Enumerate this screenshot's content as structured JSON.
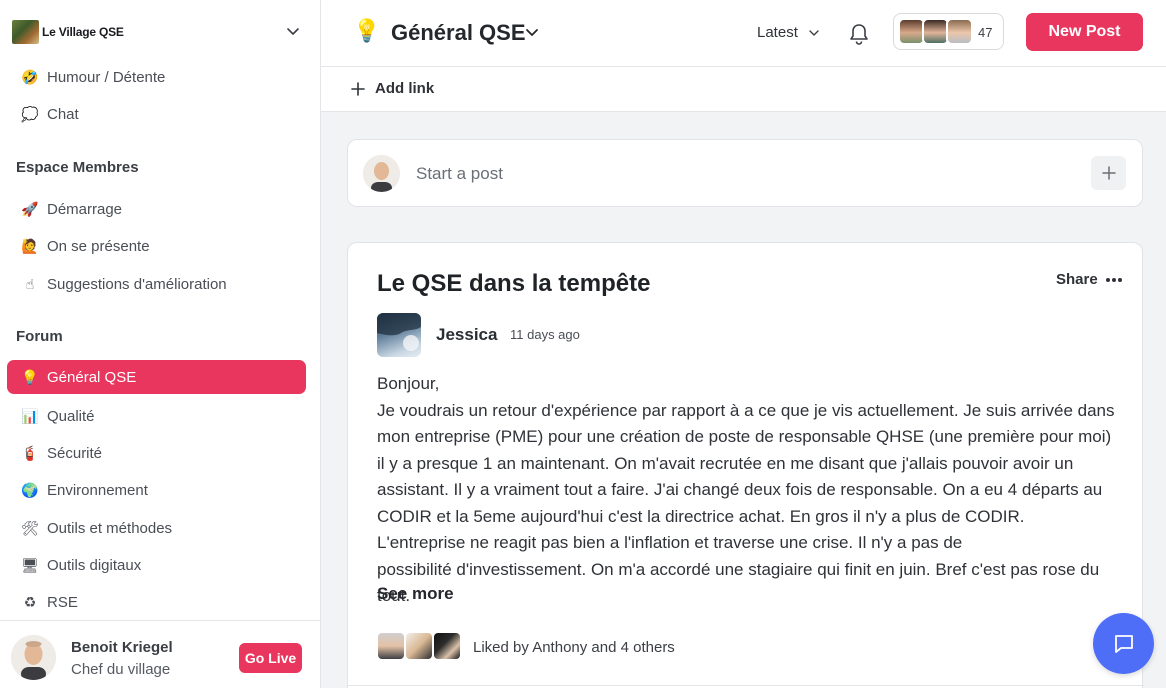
{
  "brand": {
    "name": "Le Village QSE"
  },
  "sidebar": {
    "items_top": [
      {
        "label": "Humour / Détente",
        "icon": "🤣"
      },
      {
        "label": "Chat",
        "icon": "💭"
      }
    ],
    "section_members": "Espace Membres",
    "items_members": [
      {
        "label": "Démarrage",
        "icon": "🚀"
      },
      {
        "label": "On se présente",
        "icon": "🙋"
      },
      {
        "label": "Suggestions d'amélioration",
        "icon": "☝"
      }
    ],
    "section_forum": "Forum",
    "items_forum": [
      {
        "label": "Général QSE",
        "icon": "💡"
      },
      {
        "label": "Qualité",
        "icon": "📊"
      },
      {
        "label": "Sécurité",
        "icon": "🧯"
      },
      {
        "label": "Environnement",
        "icon": "🌍"
      },
      {
        "label": "Outils et méthodes",
        "icon": "🛠"
      },
      {
        "label": "Outils digitaux",
        "icon": "🖥"
      },
      {
        "label": "RSE",
        "icon": "♻"
      }
    ]
  },
  "user": {
    "name": "Benoit Kriegel",
    "role": "Chef du village",
    "go_live": "Go Live"
  },
  "header": {
    "space_icon": "💡",
    "space_title": "Général QSE",
    "sort_label": "Latest",
    "member_count": "47",
    "new_post": "New Post",
    "add_link": "Add link"
  },
  "composer": {
    "placeholder": "Start a post"
  },
  "post": {
    "title": "Le QSE dans la tempête",
    "share": "Share",
    "author": "Jessica",
    "time": "11 days ago",
    "greeting": "Bonjour,",
    "body": "Je voudrais un retour d'expérience par rapport à a ce que je vis actuellement. Je suis arrivée dans mon entreprise (PME) pour une création de poste de responsable QHSE (une première pour moi) il y a presque 1 an maintenant. On m'avait recrutée en me disant que j'allais pouvoir avoir un assistant. Il y a vraiment tout a faire. J'ai changé deux fois de responsable. On a eu 4 départs au CODIR et la 5eme aujourd'hui c'est la directrice achat. En gros il n'y a plus de CODIR. L'entreprise ne reagit pas bien a l'inflation et traverse une crise. Il n'y a pas de",
    "body_last": "possibilité d'investissement. On m'a accordé une stagiaire qui finit en juin. Bref c'est pas rose du tout.",
    "see_more": "See more",
    "liked_by": "Liked by Anthony and 4 others"
  }
}
